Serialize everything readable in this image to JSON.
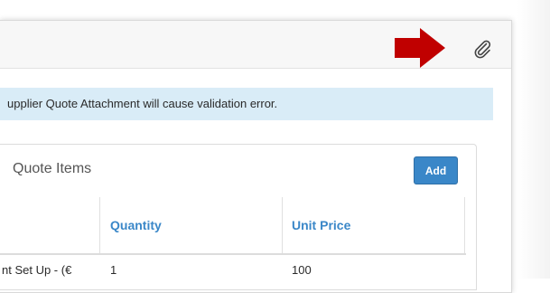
{
  "alert": {
    "message": "upplier Quote Attachment will cause validation error."
  },
  "quote_items": {
    "title": "Quote Items",
    "add_label": "Add",
    "columns": [
      "",
      "Quantity",
      "Unit Price"
    ],
    "rows": [
      {
        "item": "nt Set Up - (€",
        "quantity": "1",
        "unit_price": "100"
      }
    ]
  },
  "colors": {
    "accent": "#3a87c8",
    "alert_bg": "#d9ecf7",
    "arrow": "#c00000"
  },
  "icons": {
    "attach": "paperclip-icon",
    "pointer": "right-arrow-icon"
  }
}
